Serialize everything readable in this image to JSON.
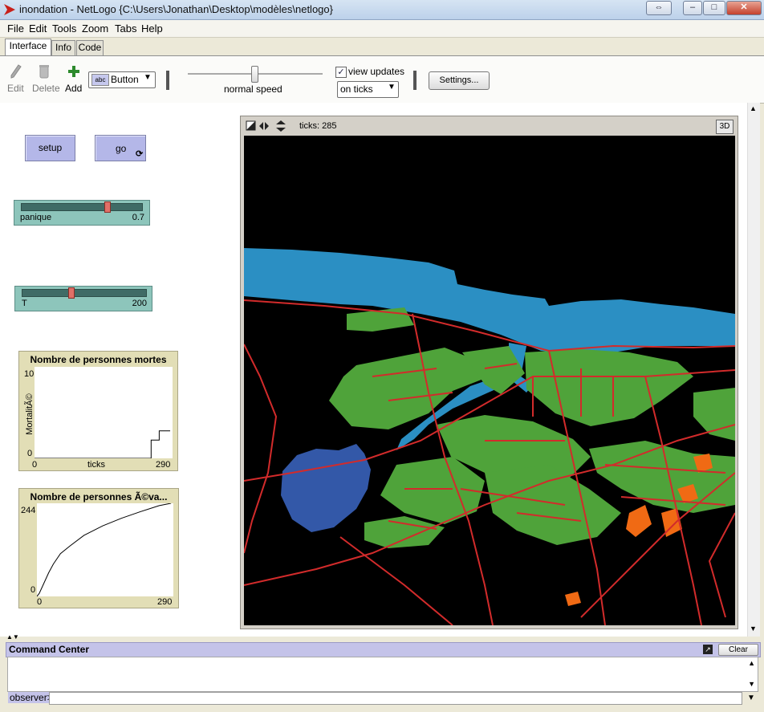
{
  "window": {
    "title": "inondation - NetLogo {C:\\Users\\Jonathan\\Desktop\\modèles\\netlogo}"
  },
  "menu": [
    "File",
    "Edit",
    "Tools",
    "Zoom",
    "Tabs",
    "Help"
  ],
  "tabs": [
    "Interface",
    "Info",
    "Code"
  ],
  "toolbar": {
    "edit": "Edit",
    "delete": "Delete",
    "add": "Add",
    "widget_type": "Button",
    "abc": "abc",
    "speed_label": "normal speed",
    "speed": 0.5,
    "view_updates": "view updates",
    "update_mode": "on ticks",
    "settings": "Settings..."
  },
  "buttons": {
    "setup": "setup",
    "go": "go"
  },
  "sliders": [
    {
      "name": "panique",
      "value": "0.7",
      "fraction": 0.78
    },
    {
      "name": "T",
      "value": "200",
      "fraction": 0.4
    }
  ],
  "plots": [
    {
      "title": "Nombre de personnes mortes",
      "ylabel": "MortalitÃ©",
      "xlabel": "ticks",
      "ymax": "10",
      "ymin": "0",
      "xmin": "0",
      "xmax": "290"
    },
    {
      "title": "Nombre de personnes Ã©va...",
      "ymax": "244",
      "ymin": "0",
      "xmin": "0",
      "xmax": "290"
    }
  ],
  "chart_data": [
    {
      "type": "line",
      "title": "Nombre de personnes mortes",
      "xlabel": "ticks",
      "ylabel": "MortalitÃ©",
      "xlim": [
        0,
        290
      ],
      "ylim": [
        0,
        10
      ],
      "series": [
        {
          "values": [
            [
              0,
              0
            ],
            [
              240,
              0
            ],
            [
              245,
              2
            ],
            [
              260,
              2
            ],
            [
              262,
              3
            ],
            [
              275,
              3
            ],
            [
              285,
              3
            ]
          ]
        }
      ]
    },
    {
      "type": "line",
      "title": "Nombre de personnes Ã©va...",
      "xlim": [
        0,
        290
      ],
      "ylim": [
        0,
        244
      ],
      "series": [
        {
          "values": [
            [
              0,
              0
            ],
            [
              5,
              8
            ],
            [
              15,
              35
            ],
            [
              25,
              62
            ],
            [
              35,
              85
            ],
            [
              50,
              112
            ],
            [
              70,
              132
            ],
            [
              100,
              160
            ],
            [
              140,
              185
            ],
            [
              180,
              205
            ],
            [
              220,
              222
            ],
            [
              260,
              238
            ],
            [
              285,
              244
            ]
          ]
        }
      ]
    }
  ],
  "view": {
    "ticks_label": "ticks: 285",
    "btn_3d": "3D"
  },
  "command_center": {
    "title": "Command Center",
    "clear": "Clear",
    "prompt": "observer>"
  },
  "colors": {
    "water": "#2b8fc3",
    "lake": "#3358a8",
    "land": "#4fa33a",
    "roads": "#d22b2b",
    "flood": "#f06a14",
    "button": "#b4b7e8",
    "slider": "#8dc5bb",
    "plot": "#e2deb6"
  }
}
